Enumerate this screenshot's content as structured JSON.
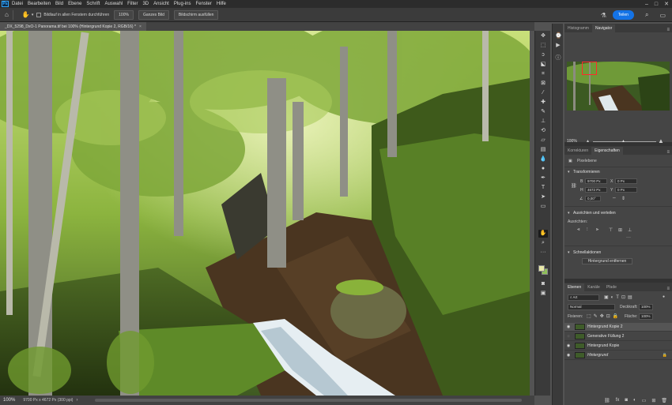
{
  "app": {
    "logo": "Ps",
    "menu": [
      "Datei",
      "Bearbeiten",
      "Bild",
      "Ebene",
      "Schrift",
      "Auswahl",
      "Filter",
      "3D",
      "Ansicht",
      "Plug-ins",
      "Fenster",
      "Hilfe"
    ],
    "window_controls": [
      "–",
      "□",
      "✕"
    ]
  },
  "options_bar": {
    "scroll_all_label": "Bildlauf in allen Fenstern durchführen",
    "zoom_value": "100%",
    "fit_button": "Ganzes Bild",
    "fill_button": "Bildschirm ausfüllen",
    "share_button": "Teilen"
  },
  "document": {
    "tab_title": "_DX_5298_DxO-1 Panorama.tif bei 100% (Hintergrund Kopie 2, RGB/16) *",
    "zoom": "100%",
    "dimensions": "9700 Px x 4672 Px (300 ppi)"
  },
  "navigator_panel": {
    "tabs": [
      "Histogramm",
      "Navigator"
    ],
    "zoom": "100%"
  },
  "properties_panel": {
    "tabs": [
      "Korrekturen",
      "Eigenschaften"
    ],
    "layer_type": "Pixelebene",
    "transform_title": "Transformieren",
    "w_label": "B",
    "w_value": "9700 Px",
    "h_label": "H",
    "h_value": "4672 Px",
    "x_label": "X",
    "x_value": "0 Px",
    "y_label": "Y",
    "y_value": "0 Px",
    "angle_value": "0,00°",
    "align_title": "Ausrichten und verteilen",
    "align_label": "Ausrichten:",
    "quick_actions_title": "Schnellaktionen",
    "remove_bg_button": "Hintergrund entfernen"
  },
  "layers_panel": {
    "tabs": [
      "Ebenen",
      "Kanäle",
      "Pfade"
    ],
    "filter_label": "Art",
    "blend_mode": "Normal",
    "opacity_label": "Deckkraft:",
    "opacity_value": "100%",
    "lock_label": "Fixieren:",
    "fill_label": "Fläche:",
    "fill_value": "100%",
    "layers": [
      {
        "name": "Hintergrund Kopie 2",
        "visible": true,
        "selected": true
      },
      {
        "name": "Generative Füllung 2",
        "visible": false,
        "selected": false
      },
      {
        "name": "Hintergrund Kopie",
        "visible": true,
        "selected": false
      },
      {
        "name": "Hintergrund",
        "visible": true,
        "selected": false,
        "locked": true
      }
    ]
  }
}
